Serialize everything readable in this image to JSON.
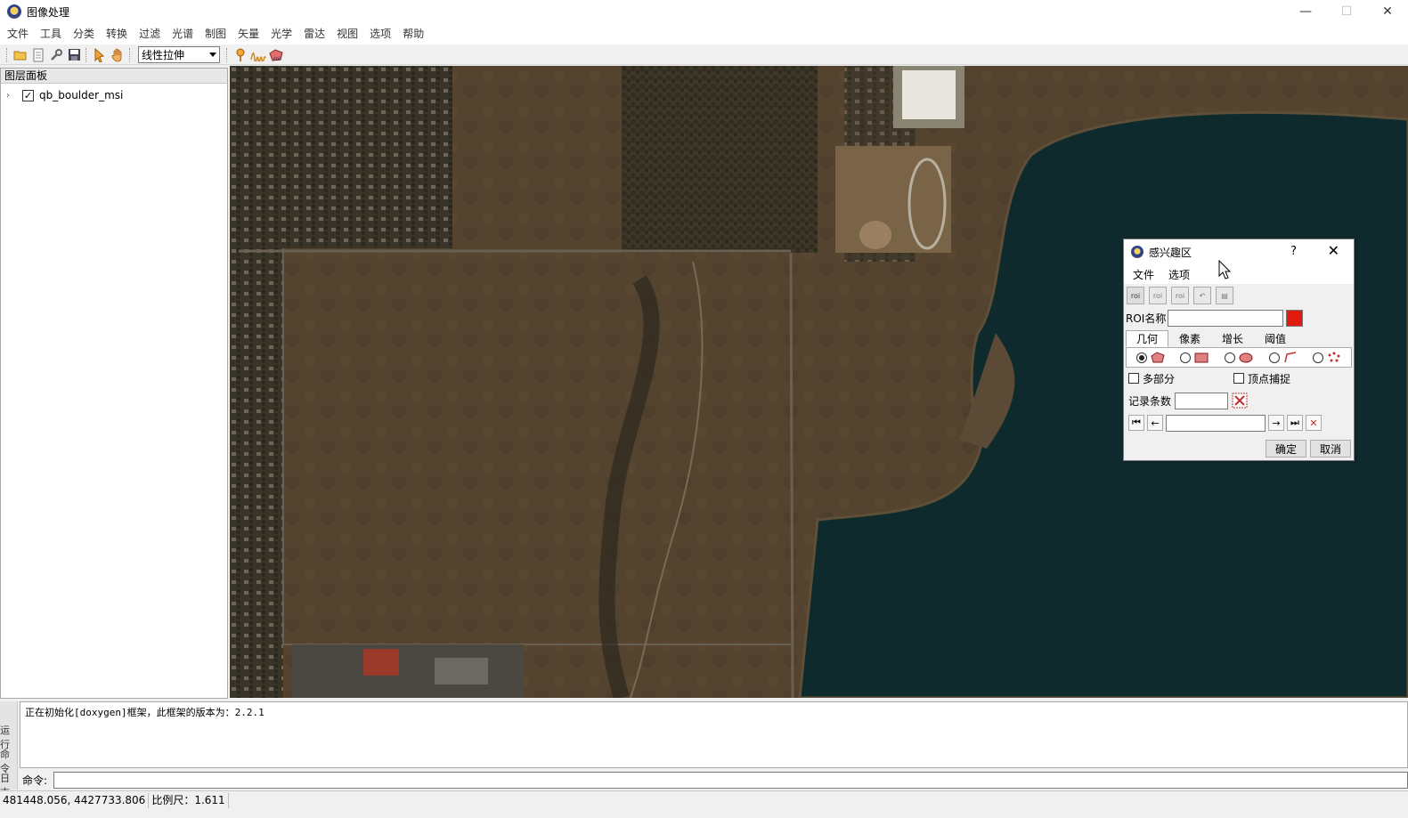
{
  "window": {
    "title": "图像处理",
    "minimize": "—",
    "maximize": "☐",
    "close": "✕"
  },
  "menu": [
    "文件",
    "工具",
    "分类",
    "转换",
    "过滤",
    "光谱",
    "制图",
    "矢量",
    "光学",
    "雷达",
    "视图",
    "选项",
    "帮助"
  ],
  "toolbar": {
    "stretch_select": "线性拉伸",
    "icons": [
      "open-icon",
      "notes-icon",
      "wrench-icon",
      "save-icon",
      "pointer-icon",
      "pan-hand-icon",
      "pin-icon",
      "spectral-profile-icon",
      "roi-tool-icon"
    ]
  },
  "layer_panel": {
    "title": "图层面板",
    "layers": [
      {
        "name": "qb_boulder_msi",
        "checked": true,
        "check_mark": "✓",
        "expander": "›"
      }
    ]
  },
  "console": {
    "side_tabs": [
      "运行",
      "命令",
      "日志"
    ],
    "message": "正在初始化[doxygen]框架，此框架的版本为：2.2.1",
    "command_label": "命令:",
    "command_value": ""
  },
  "status": {
    "coordinates": "481448.056, 4427733.806",
    "scale": "比例尺：1.611"
  },
  "roi_dialog": {
    "title": "感兴趣区",
    "help": "?",
    "close": "✕",
    "menu": [
      "文件",
      "选项"
    ],
    "name_label": "ROI名称",
    "name_value": "",
    "color": "#e11a10",
    "tabs": [
      "几何",
      "像素",
      "增长",
      "阈值"
    ],
    "active_tab": "几何",
    "geometry_selected": "polygon",
    "multipart_label": "多部分",
    "multipart_checked": false,
    "snap_label": "顶点捕捉",
    "snap_checked": false,
    "record_label": "记录条数",
    "record_value": "",
    "nav_value": "",
    "ok": "确定",
    "cancel": "取消"
  }
}
